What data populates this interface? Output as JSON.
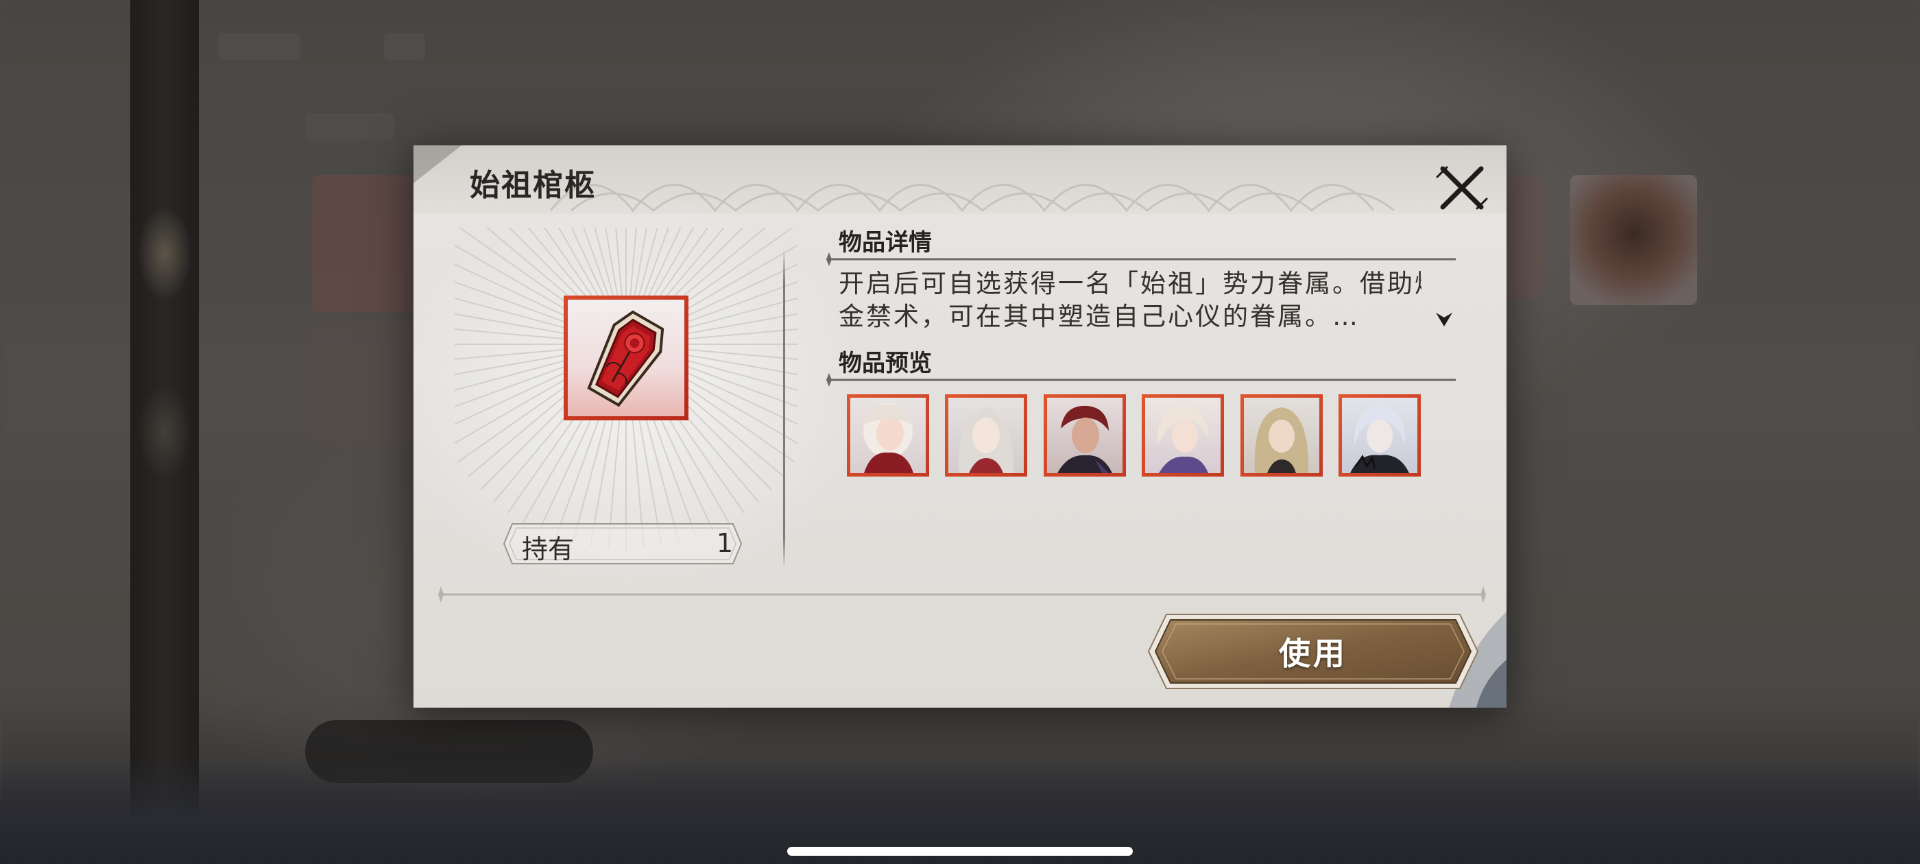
{
  "dialog": {
    "title": "始祖棺柩",
    "close_icon": "close-x-icon"
  },
  "item": {
    "icon": "coffin-with-rose-icon",
    "owned_label": "持有",
    "owned_count": "1"
  },
  "details": {
    "heading": "物品详情",
    "description_lines": [
      "开启后可自选获得一名「始祖」势力眷属。借助炼",
      "金禁术，可在其中塑造自己心仪的眷属。…"
    ],
    "expand_icon": "chevron-down-icon"
  },
  "preview": {
    "heading": "物品预览",
    "portraits": [
      {
        "icon": "character-portrait-1"
      },
      {
        "icon": "character-portrait-2"
      },
      {
        "icon": "character-portrait-3"
      },
      {
        "icon": "character-portrait-4"
      },
      {
        "icon": "character-portrait-5"
      },
      {
        "icon": "character-portrait-6"
      }
    ]
  },
  "actions": {
    "use_label": "使用"
  },
  "colors": {
    "rarity_frame": "#d84a2a",
    "button_bronze": "#8a6a43",
    "panel_bg": "#e4e2de"
  }
}
